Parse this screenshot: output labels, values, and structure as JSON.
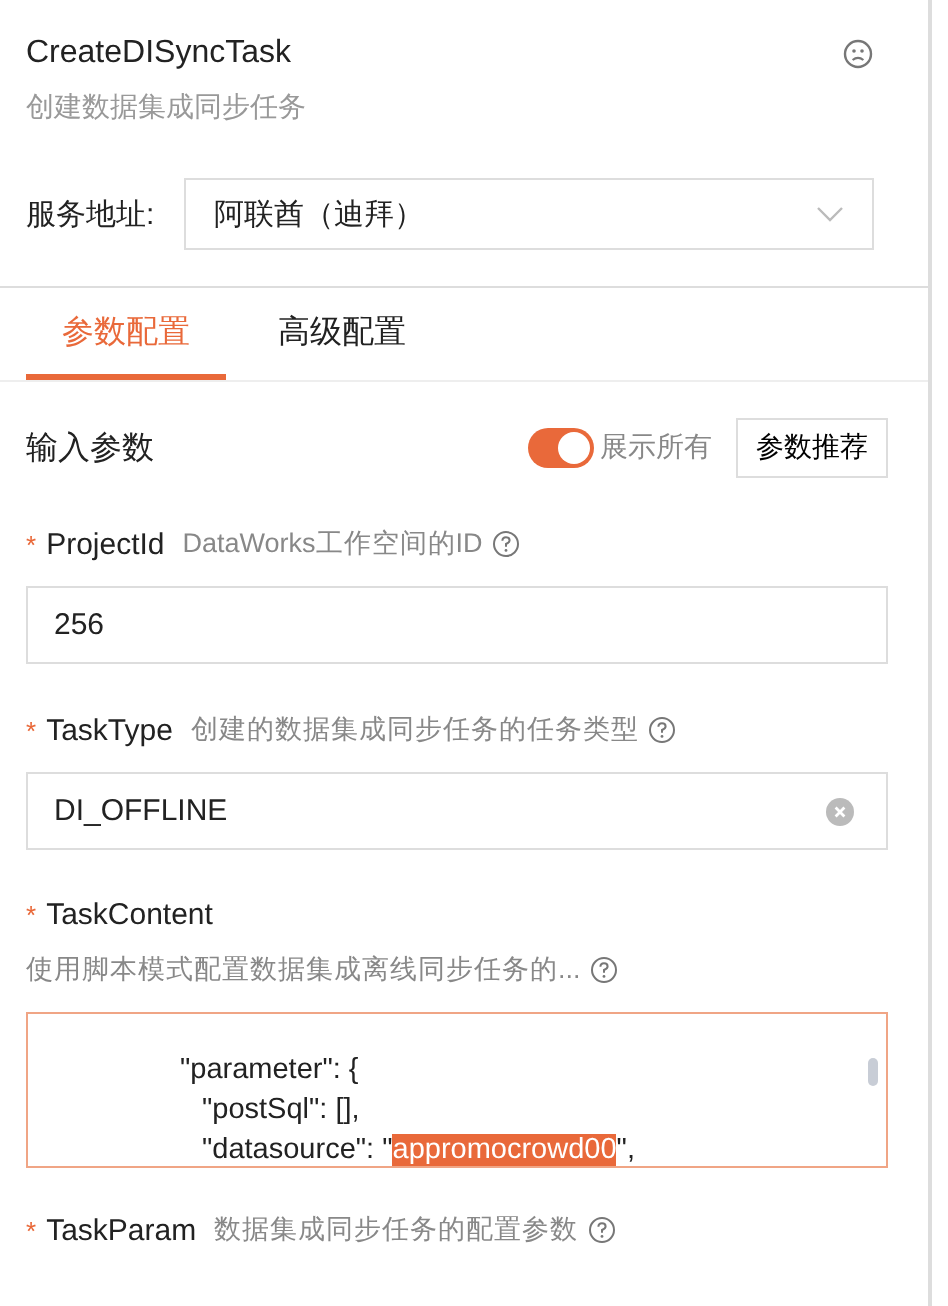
{
  "header": {
    "title": "CreateDISyncTask",
    "subtitle": "创建数据集成同步任务"
  },
  "service": {
    "label": "服务地址:",
    "value": "阿联酋（迪拜）"
  },
  "tabs": [
    {
      "label": "参数配置",
      "selected": true
    },
    {
      "label": "高级配置",
      "selected": false
    }
  ],
  "inputs": {
    "title": "输入参数",
    "show_all": {
      "label": "展示所有",
      "on": true
    },
    "recommend_button": "参数推荐"
  },
  "params": [
    {
      "kind": "input",
      "required_mark": "*",
      "name": "ProjectId",
      "description": "DataWorks工作空间的ID",
      "value": "256",
      "clearable": false
    },
    {
      "kind": "input",
      "required_mark": "*",
      "name": "TaskType",
      "description": "创建的数据集成同步任务的任务类型",
      "value": "DI_OFFLINE",
      "clearable": true
    },
    {
      "kind": "code",
      "required_mark": "*",
      "name": "TaskContent",
      "description": "使用脚本模式配置数据集成离线同步任务的...",
      "lines": [
        {
          "segments": [
            {
              "text": "\"parameter\": {",
              "selected": false
            }
          ],
          "children": [
            {
              "segments": [
                {
                  "text": "\"postSql\": [],",
                  "selected": false
                }
              ]
            },
            {
              "segments": [
                {
                  "text": "\"datasource\": \"",
                  "selected": false
                },
                {
                  "text": "appromocrowd00",
                  "selected": true
                },
                {
                  "text": "\",",
                  "selected": false
                }
              ]
            }
          ]
        }
      ]
    },
    {
      "kind": "label",
      "required_mark": "*",
      "name": "TaskParam",
      "description": "数据集成同步任务的配置参数"
    }
  ]
}
